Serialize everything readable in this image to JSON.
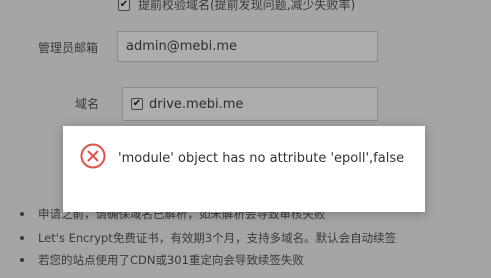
{
  "precheck": {
    "checkbox_mark": "✔",
    "label": "提前校验域名(提前发现问题,减少失败率)"
  },
  "admin_email": {
    "label": "管理员邮箱",
    "value": "admin@mebi.me"
  },
  "domain": {
    "label": "域名",
    "checkbox_mark": "✔",
    "value": "drive.mebi.me"
  },
  "notes": [
    "申请之前，请确保域名已解析，如未解析会导致审核失败",
    "Let's Encrypt免费证书，有效期3个月，支持多域名。默认会自动续签",
    "若您的站点使用了CDN或301重定向会导致续签失败"
  ],
  "dialog": {
    "icon": "error-circle-icon",
    "message": "'module' object has no attribute 'epoll',false"
  },
  "colors": {
    "error": "#e0524a",
    "overlay": "rgba(0,0,0,0.32)",
    "page_bg": "#f3f3f3"
  }
}
